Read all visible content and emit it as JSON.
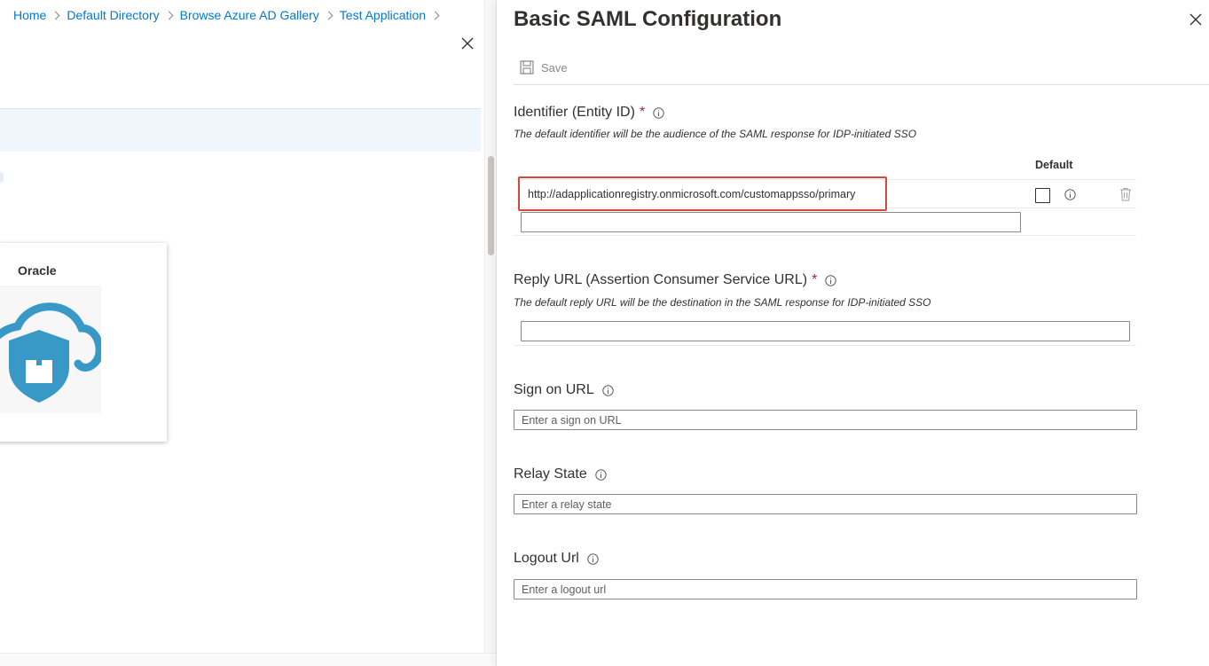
{
  "breadcrumb": [
    "Home",
    "Default Directory",
    "Browse Azure AD Gallery",
    "Test Application"
  ],
  "gallery_tile": {
    "name": "Oracle",
    "logo_icon": "cloud-shield-icon"
  },
  "blade": {
    "title": "Basic SAML Configuration",
    "save_label": "Save",
    "identifier": {
      "label": "Identifier (Entity ID)",
      "required_mark": "*",
      "description": "The default identifier will be the audience of the SAML response for IDP-initiated SSO",
      "default_column": "Default",
      "value": "http://adapplicationregistry.onmicrosoft.com/customappsso/primary",
      "new_value": "",
      "is_default": false
    },
    "reply_url": {
      "label": "Reply URL (Assertion Consumer Service URL)",
      "required_mark": "*",
      "description": "The default reply URL will be the destination in the SAML response for IDP-initiated SSO",
      "value": ""
    },
    "sign_on_url": {
      "label": "Sign on URL",
      "placeholder": "Enter a sign on URL"
    },
    "relay_state": {
      "label": "Relay State",
      "placeholder": "Enter a relay state"
    },
    "logout_url": {
      "label": "Logout Url",
      "placeholder": "Enter a logout url"
    }
  },
  "colors": {
    "link": "#0078d4",
    "required": "#a4262c",
    "highlight": "#d8473a",
    "logo_blue": "#3999c6"
  }
}
